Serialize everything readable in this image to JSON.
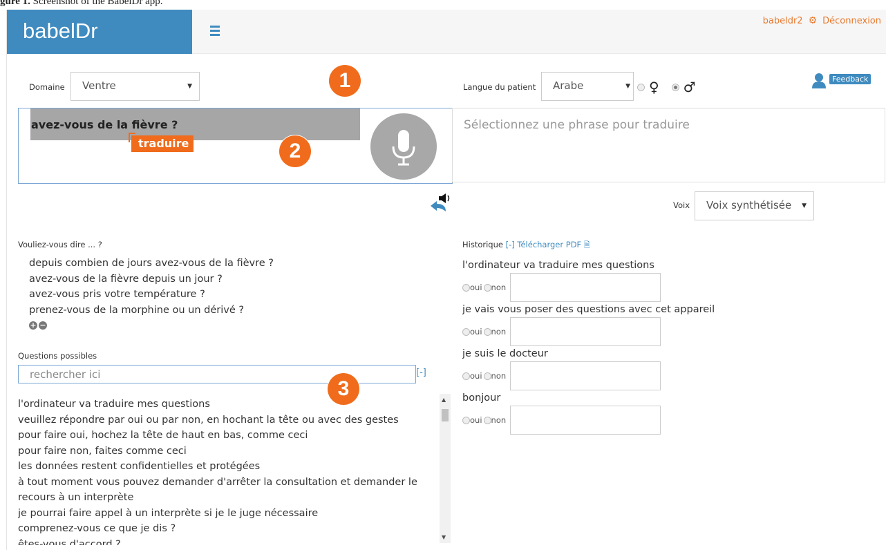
{
  "caption": {
    "prefix": "gure 1.",
    "text": "Screenshot of the BabelDr app."
  },
  "header": {
    "brand": "babelDr",
    "user": "babeldr2",
    "logout": "Déconnexion"
  },
  "controls": {
    "domain_label": "Domaine",
    "domain_value": "Ventre",
    "patient_lang_label": "Langue du patient",
    "patient_lang_value": "Arabe",
    "feedback": "Feedback",
    "voice_label": "Voix",
    "voice_value": "Voix synthétisée"
  },
  "badges": [
    "1",
    "2",
    "3"
  ],
  "input": {
    "phrase": "avez-vous de la fièvre ?",
    "translate": "traduire"
  },
  "output": {
    "placeholder": "Sélectionnez une phrase pour traduire"
  },
  "suggestions": {
    "title": "Vouliez-vous dire ... ?",
    "items": [
      "depuis combien de jours avez-vous de la fièvre ?",
      "avez-vous de la fièvre depuis un jour ?",
      "avez-vous pris votre température ?",
      "prenez-vous de la morphine ou un dérivé ?"
    ]
  },
  "questions": {
    "title": "Questions possibles",
    "search_placeholder": "rechercher ici",
    "toggle": "[-]",
    "items": [
      "l'ordinateur va traduire mes questions",
      "veuillez répondre par oui ou par non, en hochant la tête ou avec des gestes",
      "pour faire oui, hochez la tête de haut en bas, comme ceci",
      "pour faire non, faites comme ceci",
      "les données restent confidentielles et protégées",
      "à tout moment vous pouvez demander d'arrêter la consultation et demander le recours à un interprète",
      "je pourrai faire appel à un interprète si je le juge nécessaire",
      "comprenez-vous ce que je dis ?",
      "êtes-vous d'accord ?"
    ]
  },
  "history": {
    "title": "Historique",
    "toggle": "[-]",
    "download": "Télécharger PDF",
    "yes": "oui",
    "no": "non",
    "items": [
      "l'ordinateur va traduire mes questions",
      "je vais vous poser des questions avec cet appareil",
      "je suis le docteur",
      "bonjour"
    ]
  },
  "colors": {
    "brand": "#3f8bc0",
    "accent": "#f06c1c",
    "link": "#e8792e"
  }
}
